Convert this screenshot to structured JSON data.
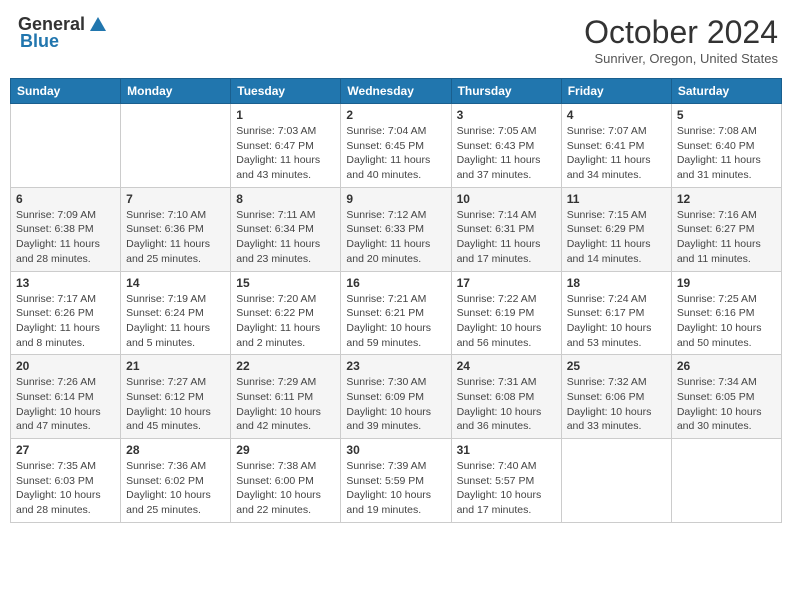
{
  "header": {
    "logo_general": "General",
    "logo_blue": "Blue",
    "title": "October 2024",
    "location": "Sunriver, Oregon, United States"
  },
  "days_of_week": [
    "Sunday",
    "Monday",
    "Tuesday",
    "Wednesday",
    "Thursday",
    "Friday",
    "Saturday"
  ],
  "weeks": [
    [
      {
        "day": "",
        "content": ""
      },
      {
        "day": "",
        "content": ""
      },
      {
        "day": "1",
        "content": "Sunrise: 7:03 AM\nSunset: 6:47 PM\nDaylight: 11 hours and 43 minutes."
      },
      {
        "day": "2",
        "content": "Sunrise: 7:04 AM\nSunset: 6:45 PM\nDaylight: 11 hours and 40 minutes."
      },
      {
        "day": "3",
        "content": "Sunrise: 7:05 AM\nSunset: 6:43 PM\nDaylight: 11 hours and 37 minutes."
      },
      {
        "day": "4",
        "content": "Sunrise: 7:07 AM\nSunset: 6:41 PM\nDaylight: 11 hours and 34 minutes."
      },
      {
        "day": "5",
        "content": "Sunrise: 7:08 AM\nSunset: 6:40 PM\nDaylight: 11 hours and 31 minutes."
      }
    ],
    [
      {
        "day": "6",
        "content": "Sunrise: 7:09 AM\nSunset: 6:38 PM\nDaylight: 11 hours and 28 minutes."
      },
      {
        "day": "7",
        "content": "Sunrise: 7:10 AM\nSunset: 6:36 PM\nDaylight: 11 hours and 25 minutes."
      },
      {
        "day": "8",
        "content": "Sunrise: 7:11 AM\nSunset: 6:34 PM\nDaylight: 11 hours and 23 minutes."
      },
      {
        "day": "9",
        "content": "Sunrise: 7:12 AM\nSunset: 6:33 PM\nDaylight: 11 hours and 20 minutes."
      },
      {
        "day": "10",
        "content": "Sunrise: 7:14 AM\nSunset: 6:31 PM\nDaylight: 11 hours and 17 minutes."
      },
      {
        "day": "11",
        "content": "Sunrise: 7:15 AM\nSunset: 6:29 PM\nDaylight: 11 hours and 14 minutes."
      },
      {
        "day": "12",
        "content": "Sunrise: 7:16 AM\nSunset: 6:27 PM\nDaylight: 11 hours and 11 minutes."
      }
    ],
    [
      {
        "day": "13",
        "content": "Sunrise: 7:17 AM\nSunset: 6:26 PM\nDaylight: 11 hours and 8 minutes."
      },
      {
        "day": "14",
        "content": "Sunrise: 7:19 AM\nSunset: 6:24 PM\nDaylight: 11 hours and 5 minutes."
      },
      {
        "day": "15",
        "content": "Sunrise: 7:20 AM\nSunset: 6:22 PM\nDaylight: 11 hours and 2 minutes."
      },
      {
        "day": "16",
        "content": "Sunrise: 7:21 AM\nSunset: 6:21 PM\nDaylight: 10 hours and 59 minutes."
      },
      {
        "day": "17",
        "content": "Sunrise: 7:22 AM\nSunset: 6:19 PM\nDaylight: 10 hours and 56 minutes."
      },
      {
        "day": "18",
        "content": "Sunrise: 7:24 AM\nSunset: 6:17 PM\nDaylight: 10 hours and 53 minutes."
      },
      {
        "day": "19",
        "content": "Sunrise: 7:25 AM\nSunset: 6:16 PM\nDaylight: 10 hours and 50 minutes."
      }
    ],
    [
      {
        "day": "20",
        "content": "Sunrise: 7:26 AM\nSunset: 6:14 PM\nDaylight: 10 hours and 47 minutes."
      },
      {
        "day": "21",
        "content": "Sunrise: 7:27 AM\nSunset: 6:12 PM\nDaylight: 10 hours and 45 minutes."
      },
      {
        "day": "22",
        "content": "Sunrise: 7:29 AM\nSunset: 6:11 PM\nDaylight: 10 hours and 42 minutes."
      },
      {
        "day": "23",
        "content": "Sunrise: 7:30 AM\nSunset: 6:09 PM\nDaylight: 10 hours and 39 minutes."
      },
      {
        "day": "24",
        "content": "Sunrise: 7:31 AM\nSunset: 6:08 PM\nDaylight: 10 hours and 36 minutes."
      },
      {
        "day": "25",
        "content": "Sunrise: 7:32 AM\nSunset: 6:06 PM\nDaylight: 10 hours and 33 minutes."
      },
      {
        "day": "26",
        "content": "Sunrise: 7:34 AM\nSunset: 6:05 PM\nDaylight: 10 hours and 30 minutes."
      }
    ],
    [
      {
        "day": "27",
        "content": "Sunrise: 7:35 AM\nSunset: 6:03 PM\nDaylight: 10 hours and 28 minutes."
      },
      {
        "day": "28",
        "content": "Sunrise: 7:36 AM\nSunset: 6:02 PM\nDaylight: 10 hours and 25 minutes."
      },
      {
        "day": "29",
        "content": "Sunrise: 7:38 AM\nSunset: 6:00 PM\nDaylight: 10 hours and 22 minutes."
      },
      {
        "day": "30",
        "content": "Sunrise: 7:39 AM\nSunset: 5:59 PM\nDaylight: 10 hours and 19 minutes."
      },
      {
        "day": "31",
        "content": "Sunrise: 7:40 AM\nSunset: 5:57 PM\nDaylight: 10 hours and 17 minutes."
      },
      {
        "day": "",
        "content": ""
      },
      {
        "day": "",
        "content": ""
      }
    ]
  ]
}
